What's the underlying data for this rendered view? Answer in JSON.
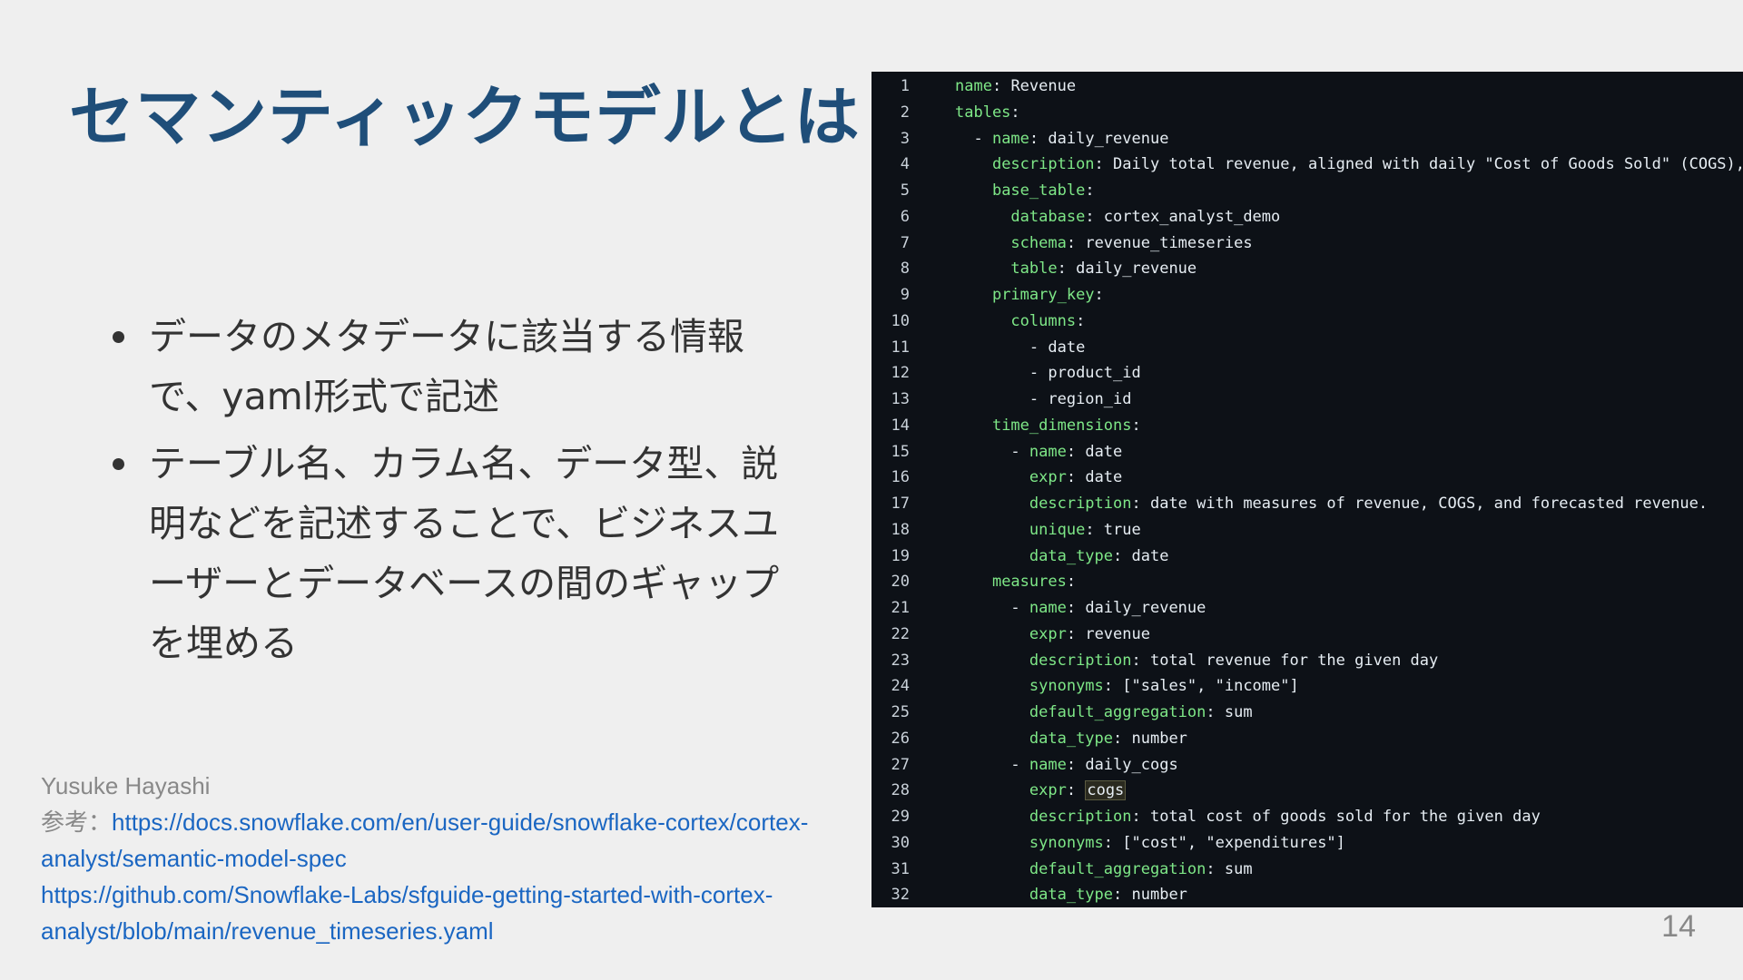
{
  "slide": {
    "title": "セマンティックモデルとは",
    "bullets": [
      "データのメタデータに該当する情報で、yaml形式で記述",
      "テーブル名、カラム名、データ型、説明などを記述することで、ビジネスユーザーとデータベースの間のギャップを埋める"
    ],
    "author": "Yusuke Hayashi",
    "reference_label": "参考：",
    "links": [
      "https://docs.snowflake.com/en/user-guide/snowflake-cortex/cortex-analyst/semantic-model-spec",
      "https://github.com/Snowflake-Labs/sfguide-getting-started-with-cortex-analyst/blob/main/revenue_timeseries.yaml"
    ],
    "page_number": "14"
  },
  "code": {
    "lines": [
      {
        "n": "1",
        "indent": "",
        "dash": "",
        "key": "name",
        "value": " Revenue"
      },
      {
        "n": "2",
        "indent": "",
        "dash": "",
        "key": "tables",
        "value": ""
      },
      {
        "n": "3",
        "indent": "  ",
        "dash": "- ",
        "key": "name",
        "value": " daily_revenue"
      },
      {
        "n": "4",
        "indent": "    ",
        "dash": "",
        "key": "description",
        "value": " Daily total revenue, aligned with daily \"Cost of Goods Sold\" (COGS), and forecasted revenue."
      },
      {
        "n": "5",
        "indent": "    ",
        "dash": "",
        "key": "base_table",
        "value": ""
      },
      {
        "n": "6",
        "indent": "      ",
        "dash": "",
        "key": "database",
        "value": " cortex_analyst_demo"
      },
      {
        "n": "7",
        "indent": "      ",
        "dash": "",
        "key": "schema",
        "value": " revenue_timeseries"
      },
      {
        "n": "8",
        "indent": "      ",
        "dash": "",
        "key": "table",
        "value": " daily_revenue"
      },
      {
        "n": "9",
        "indent": "    ",
        "dash": "",
        "key": "primary_key",
        "value": ""
      },
      {
        "n": "10",
        "indent": "      ",
        "dash": "",
        "key": "columns",
        "value": ""
      },
      {
        "n": "11",
        "indent": "        ",
        "dash": "- ",
        "key": "",
        "value": "date"
      },
      {
        "n": "12",
        "indent": "        ",
        "dash": "- ",
        "key": "",
        "value": "product_id"
      },
      {
        "n": "13",
        "indent": "        ",
        "dash": "- ",
        "key": "",
        "value": "region_id"
      },
      {
        "n": "14",
        "indent": "    ",
        "dash": "",
        "key": "time_dimensions",
        "value": ""
      },
      {
        "n": "15",
        "indent": "      ",
        "dash": "- ",
        "key": "name",
        "value": " date"
      },
      {
        "n": "16",
        "indent": "        ",
        "dash": "",
        "key": "expr",
        "value": " date"
      },
      {
        "n": "17",
        "indent": "        ",
        "dash": "",
        "key": "description",
        "value": " date with measures of revenue, COGS, and forecasted revenue."
      },
      {
        "n": "18",
        "indent": "        ",
        "dash": "",
        "key": "unique",
        "value": " true"
      },
      {
        "n": "19",
        "indent": "        ",
        "dash": "",
        "key": "data_type",
        "value": " date"
      },
      {
        "n": "20",
        "indent": "    ",
        "dash": "",
        "key": "measures",
        "value": ""
      },
      {
        "n": "21",
        "indent": "      ",
        "dash": "- ",
        "key": "name",
        "value": " daily_revenue"
      },
      {
        "n": "22",
        "indent": "        ",
        "dash": "",
        "key": "expr",
        "value": " revenue"
      },
      {
        "n": "23",
        "indent": "        ",
        "dash": "",
        "key": "description",
        "value": " total revenue for the given day"
      },
      {
        "n": "24",
        "indent": "        ",
        "dash": "",
        "key": "synonyms",
        "value": " [\"sales\", \"income\"]"
      },
      {
        "n": "25",
        "indent": "        ",
        "dash": "",
        "key": "default_aggregation",
        "value": " sum"
      },
      {
        "n": "26",
        "indent": "        ",
        "dash": "",
        "key": "data_type",
        "value": " number"
      },
      {
        "n": "27",
        "indent": "      ",
        "dash": "- ",
        "key": "name",
        "value": " daily_cogs"
      },
      {
        "n": "28",
        "indent": "        ",
        "dash": "",
        "key": "expr",
        "value": " cogs",
        "highlight": true
      },
      {
        "n": "29",
        "indent": "        ",
        "dash": "",
        "key": "description",
        "value": " total cost of goods sold for the given day"
      },
      {
        "n": "30",
        "indent": "        ",
        "dash": "",
        "key": "synonyms",
        "value": " [\"cost\", \"expenditures\"]"
      },
      {
        "n": "31",
        "indent": "        ",
        "dash": "",
        "key": "default_aggregation",
        "value": " sum"
      },
      {
        "n": "32",
        "indent": "        ",
        "dash": "",
        "key": "data_type",
        "value": " number"
      }
    ]
  }
}
